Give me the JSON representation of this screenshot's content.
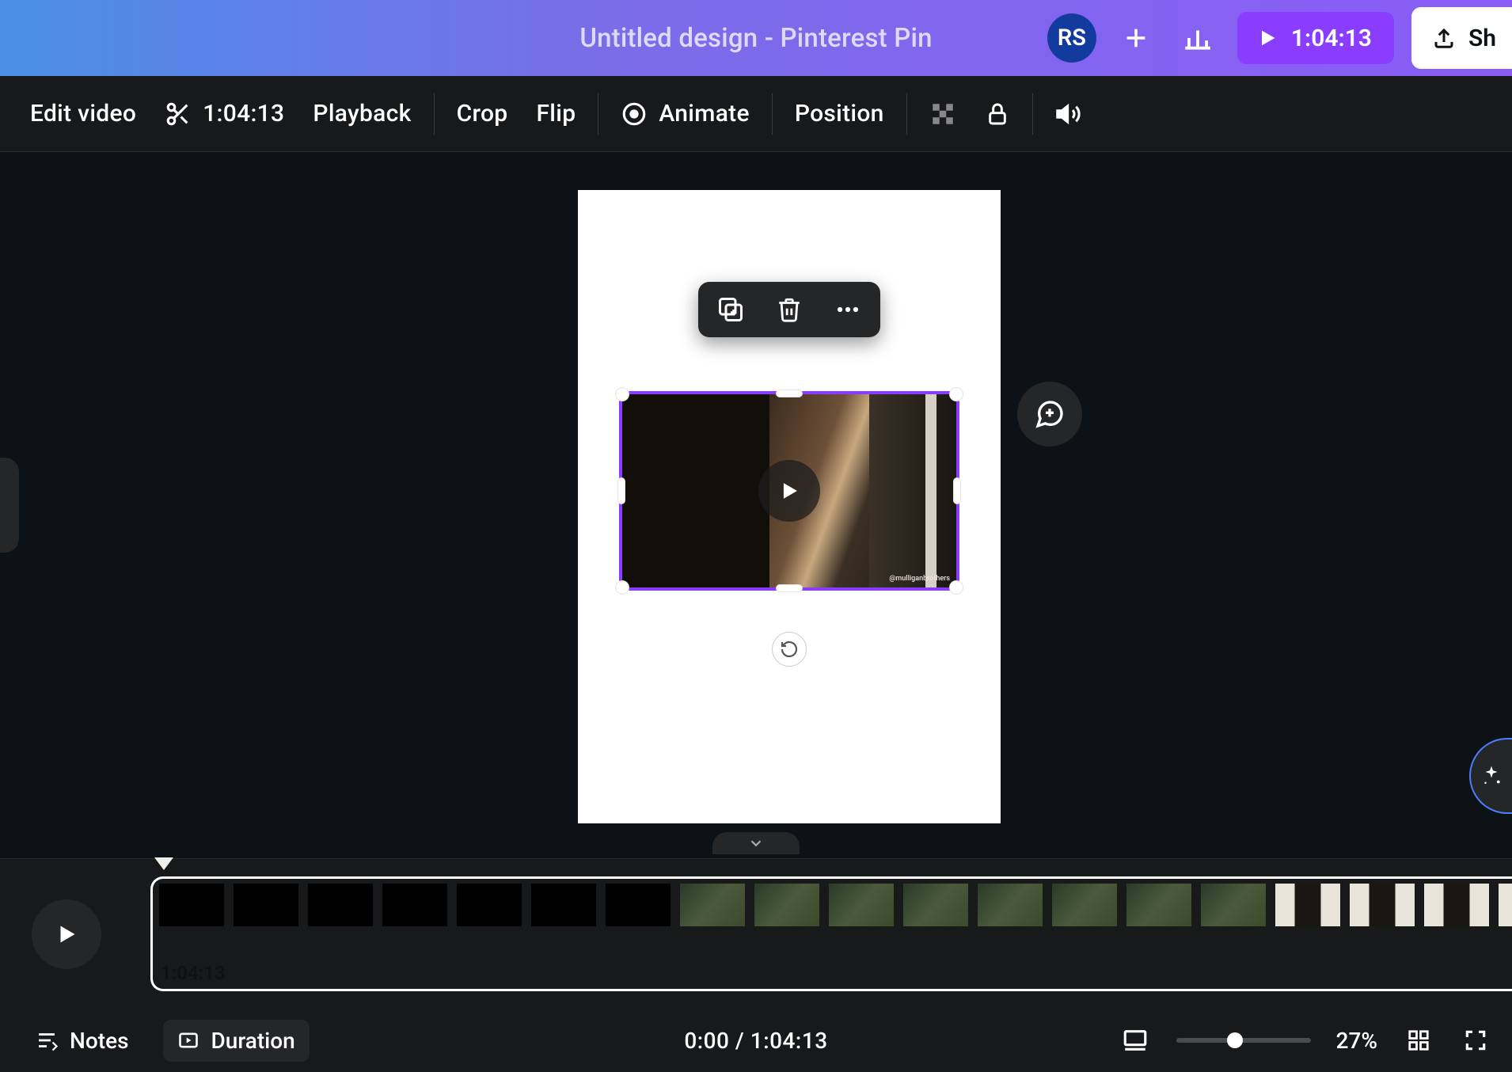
{
  "header": {
    "doc_title": "Untitled design - Pinterest Pin",
    "avatar_initials": "RS",
    "play_duration": "1:04:13",
    "share_label": "Sh"
  },
  "toolbar": {
    "edit_video": "Edit video",
    "trim_time": "1:04:13",
    "playback": "Playback",
    "crop": "Crop",
    "flip": "Flip",
    "animate": "Animate",
    "position": "Position"
  },
  "canvas": {
    "watermark": "@mulliganbrothers"
  },
  "timeline": {
    "clip_duration": "1:04:13"
  },
  "footer": {
    "notes": "Notes",
    "duration": "Duration",
    "time_display": "0:00 / 1:04:13",
    "zoom_pct": "27%"
  }
}
